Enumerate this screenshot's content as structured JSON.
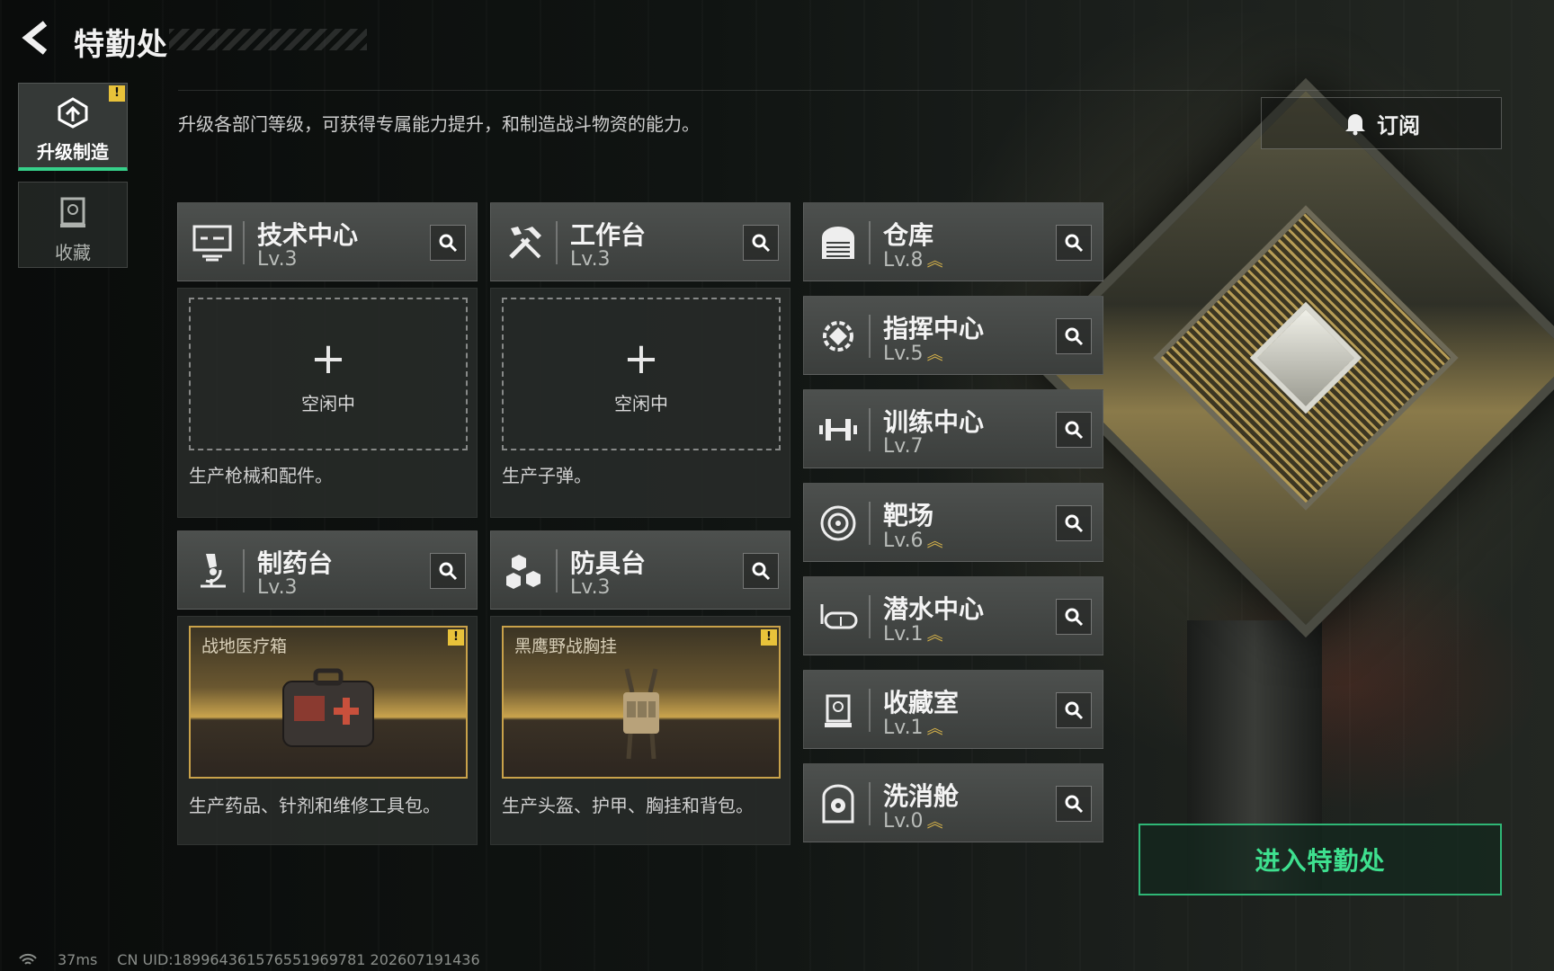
{
  "header": {
    "title": "特勤处",
    "description": "升级各部门等级，可获得专属能力提升，和制造战斗物资的能力。"
  },
  "side_tabs": [
    {
      "label": "升级制造",
      "icon": "upgrade-icon",
      "active": true,
      "badge": "!"
    },
    {
      "label": "收藏",
      "icon": "collection-icon",
      "active": false
    }
  ],
  "subscribe": {
    "label": "订阅",
    "icon": "bell-icon"
  },
  "production_cards": [
    {
      "name": "技术中心",
      "level": "Lv.3",
      "icon": "monitor-icon",
      "state": "空闲中",
      "desc": "生产枪械和配件。"
    },
    {
      "name": "工作台",
      "level": "Lv.3",
      "icon": "tools-icon",
      "state": "空闲中",
      "desc": "生产子弹。"
    },
    {
      "name": "制药台",
      "level": "Lv.3",
      "icon": "microscope-icon",
      "product": "战地医疗箱",
      "desc": "生产药品、针剂和维修工具包。"
    },
    {
      "name": "防具台",
      "level": "Lv.3",
      "icon": "armor-blocks-icon",
      "product": "黑鹰野战胸挂",
      "desc": "生产头盔、护甲、胸挂和背包。"
    }
  ],
  "facilities": [
    {
      "name": "仓库",
      "level": "Lv.8",
      "upgradable": true,
      "icon": "warehouse-icon"
    },
    {
      "name": "指挥中心",
      "level": "Lv.5",
      "upgradable": true,
      "icon": "command-icon"
    },
    {
      "name": "训练中心",
      "level": "Lv.7",
      "upgradable": false,
      "icon": "dumbbell-icon"
    },
    {
      "name": "靶场",
      "level": "Lv.6",
      "upgradable": true,
      "icon": "target-icon"
    },
    {
      "name": "潜水中心",
      "level": "Lv.1",
      "upgradable": true,
      "icon": "diving-mask-icon"
    },
    {
      "name": "收藏室",
      "level": "Lv.1",
      "upgradable": true,
      "icon": "display-case-icon"
    },
    {
      "name": "洗消舱",
      "level": "Lv.0",
      "upgradable": true,
      "icon": "hazmat-icon"
    }
  ],
  "enter_button": {
    "label": "进入特勤处"
  },
  "footer": {
    "ping": "37ms",
    "uid": "CN UID:18996436157655196978​1 202607191436"
  },
  "colors": {
    "accent_green": "#36d08a",
    "upgrade_gold": "#d9b54a",
    "product_border": "#c9a24a"
  }
}
